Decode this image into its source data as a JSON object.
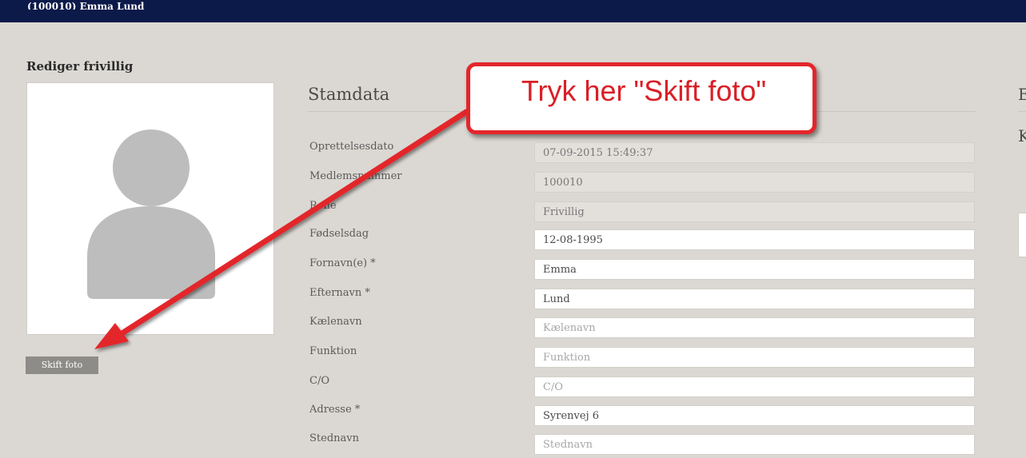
{
  "header": {
    "title": "(100010) Emma Lund"
  },
  "page": {
    "title": "Rediger frivillig"
  },
  "photo": {
    "change_button_label": "Skift foto"
  },
  "section": {
    "title": "Stamdata"
  },
  "right_column": {
    "heading1": "E",
    "heading2": "K"
  },
  "callout": {
    "text": "Tryk her \"Skift foto\"",
    "color": "#e3262b"
  },
  "fields": {
    "oprettelsesdato": {
      "label": "Oprettelsesdato",
      "value": "07-09-2015 15:49:37"
    },
    "medlemsnummer": {
      "label": "Medlemsnummer",
      "value": "100010"
    },
    "rolle": {
      "label": "Rolle",
      "value": "Frivillig"
    },
    "fodselsdag": {
      "label": "Fødselsdag",
      "value": "12-08-1995"
    },
    "fornavn": {
      "label": "Fornavn(e) *",
      "value": "Emma"
    },
    "efternavn": {
      "label": "Efternavn *",
      "value": "Lund"
    },
    "kaelenavn": {
      "label": "Kælenavn",
      "placeholder": "Kælenavn"
    },
    "funktion": {
      "label": "Funktion",
      "placeholder": "Funktion"
    },
    "co": {
      "label": "C/O",
      "placeholder": "C/O"
    },
    "adresse": {
      "label": "Adresse *",
      "value": "Syrenvej 6"
    },
    "stednavn": {
      "label": "Stednavn",
      "placeholder": "Stednavn"
    }
  }
}
